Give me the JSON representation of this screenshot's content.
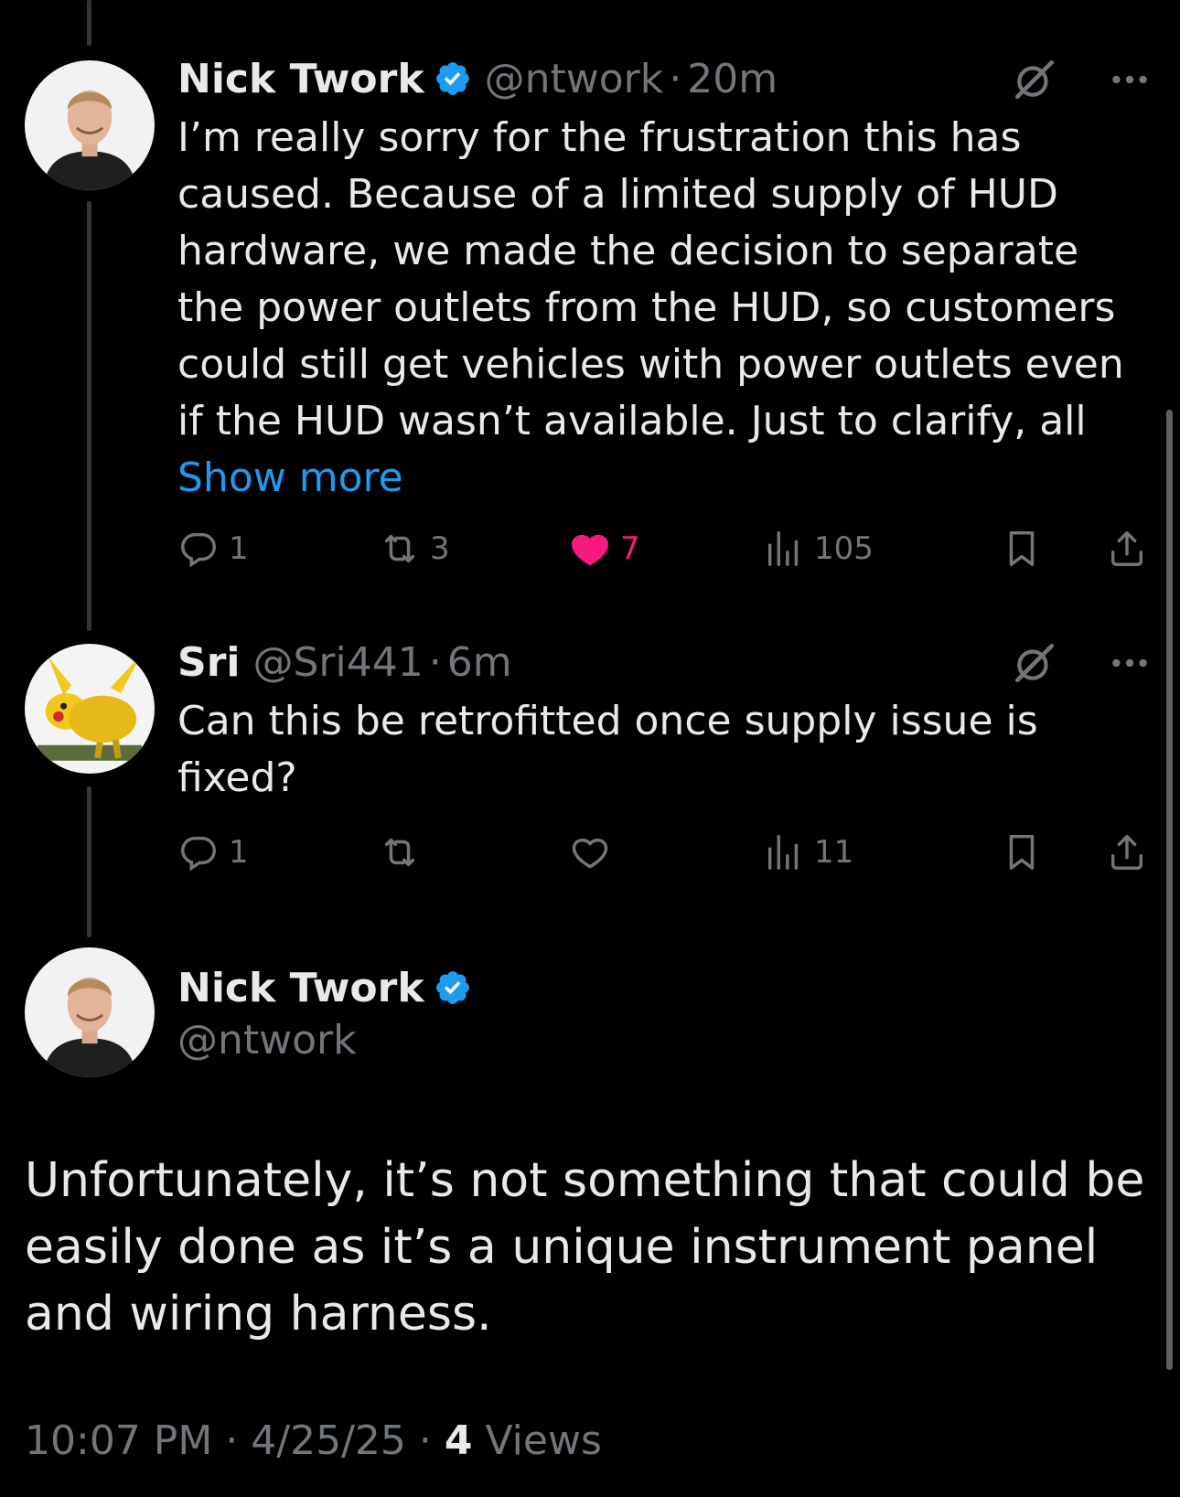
{
  "tweets": [
    {
      "display_name": "Nick Twork",
      "verified": true,
      "handle": "@ntwork",
      "separator": "·",
      "time": "20m",
      "text": "I’m really sorry for the frustration this has caused. Because of a limited supply of HUD hardware, we made the decision to separate the power outlets from the HUD, so customers could still get vehicles with power outlets even if the HUD wasn’t available. Just to clarify, all ",
      "show_more": "Show more",
      "replies": "1",
      "reposts": "3",
      "likes": "7",
      "liked": true,
      "views": "105"
    },
    {
      "display_name": "Sri",
      "verified": false,
      "handle": "@Sri441",
      "separator": "·",
      "time": "6m",
      "text": "Can this be retrofitted once supply issue is fixed?",
      "replies": "1",
      "reposts": "",
      "likes": "",
      "liked": false,
      "views": "11"
    }
  ],
  "main_tweet": {
    "display_name": "Nick Twork",
    "verified": true,
    "handle": "@ntwork",
    "text": "Unfortunately, it’s not something that could be easily done as it’s a unique instrument panel and wiring harness.",
    "time": "10:07 PM",
    "date": "4/25/25",
    "separator": "·",
    "views_count": "4",
    "views_label": "Views"
  },
  "colors": {
    "background": "#000000",
    "text": "#e7e9ea",
    "muted": "#71767b",
    "link": "#1d9bf0",
    "like": "#f91880",
    "verified": "#1d9bf0"
  },
  "icons": {
    "reply": "reply-icon",
    "repost": "repost-icon",
    "like": "heart-icon",
    "views": "views-icon",
    "bookmark": "bookmark-icon",
    "share": "share-icon",
    "grok": "grok-icon",
    "more": "more-icon",
    "verified": "verified-badge-icon"
  }
}
